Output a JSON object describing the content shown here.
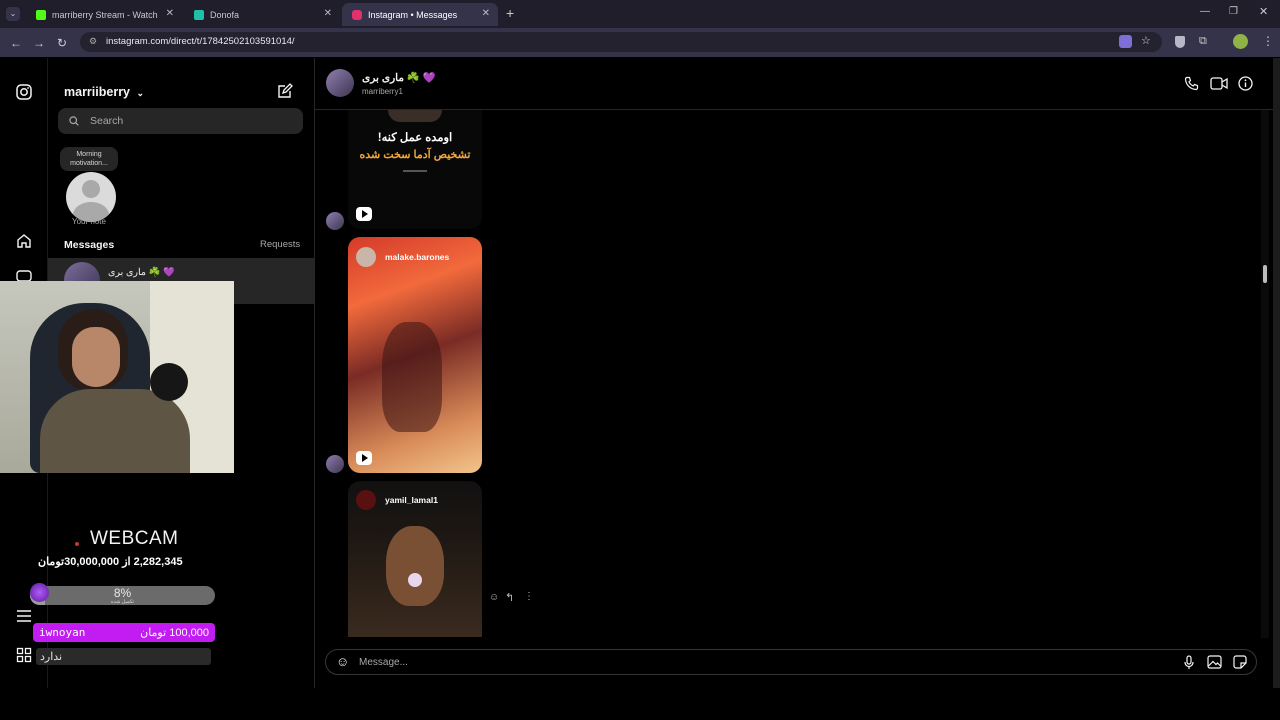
{
  "browser": {
    "tabs": [
      {
        "title": "marriberry Stream - Watch Live",
        "color": "#53fc18"
      },
      {
        "title": "Donofa",
        "color": "#20c0a8"
      },
      {
        "title": "Instagram • Messages",
        "color": "#e1306c"
      }
    ],
    "url": "instagram.com/direct/t/17842502103591014/"
  },
  "sidebar": {
    "username": "marriiberry",
    "search_placeholder": "Search",
    "note_bubble": "Morning motivation...",
    "note_label": "Your note",
    "messages_heading": "Messages",
    "requests_link": "Requests",
    "thread_name": "ماری بری ☘️ 💜"
  },
  "chat": {
    "contact_name": "ماری بری ☘️ 💜",
    "contact_handle": "marriberry1",
    "card1_text_line1": "اومده عمل کنه!",
    "card1_text_line2": "تشخیص آدما سخت شده",
    "card2_user": "malake.barones",
    "card3_user": "yamil_lamal1",
    "composer_placeholder": "Message..."
  },
  "overlay": {
    "webcam_label": "WEBCAM",
    "goal_text": "2,282,345 از 30,000,000تومان",
    "goal_percent_text": "8%",
    "goal_percent_value": 8,
    "goal_sub": "تکمیل شده",
    "donor_name": "iwnoyan",
    "donor_amount": "100,000 تومان",
    "donor_note": "ندارد"
  },
  "colors": {
    "accent_purple": "#c21cf2",
    "ig_bg": "#000000",
    "chrome_tab": "#35334a"
  }
}
